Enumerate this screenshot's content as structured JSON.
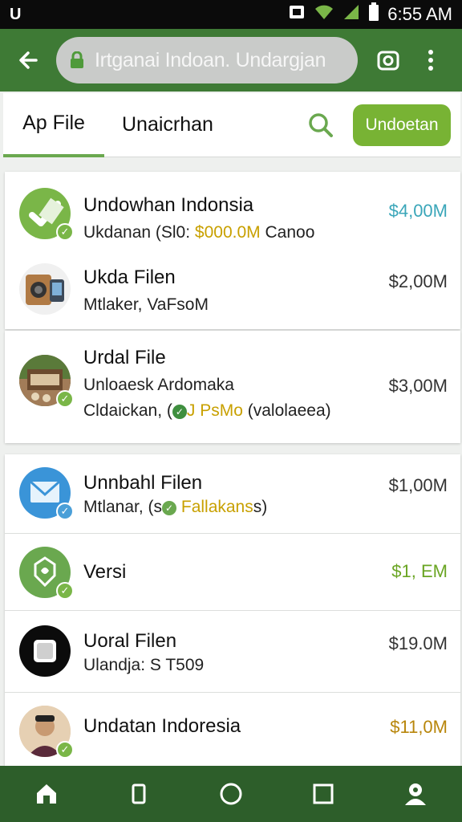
{
  "status_bar": {
    "left_glyph": "U",
    "time": "6:55 AM",
    "icons": [
      "notification-icon",
      "wifi-icon",
      "signal-icon",
      "battery-icon"
    ]
  },
  "app_bar": {
    "url_text": "Irtganai Indoan. Undargjan",
    "icons": [
      "back-arrow-icon",
      "lock-icon",
      "camera-icon",
      "more-vert-icon"
    ]
  },
  "tabs": {
    "tab1": "Ap File",
    "tab2": "Unaicrhan",
    "cta": "Undoetan"
  },
  "items": [
    {
      "title": "Undowhan Indonsia",
      "sub_pre": "Ukdanan (Sl0: ",
      "sub_hl": "$000.0M",
      "sub_post": " Canoo",
      "price": "$4,00M",
      "price_color": "#3aa6b9",
      "icon": "green-check-app-icon"
    },
    {
      "title": "Ukda Filen",
      "sub": "Mtlaker, VaFsoM",
      "price": "$2,00M",
      "price_color": "#333333",
      "icon": "camera-device-icon"
    },
    {
      "title": "Urdal File",
      "sub": "Unloaesk Ardomaka",
      "sub2_pre": "Cldaickan, (",
      "sub2_hl": "J PsMo",
      "sub2_post": " (valolaeea)",
      "price": "$3,00M",
      "price_color": "#333333",
      "icon": "market-photo-icon"
    },
    {
      "title": "Unnbahl Filen",
      "sub_pre": "Mtlanar, (s",
      "sub_hl": " Fallakans",
      "sub_post": "s)",
      "price": "$1,00M",
      "price_color": "#333333",
      "icon": "mail-app-icon"
    },
    {
      "title": "Versi",
      "price": "$1, EM",
      "price_color": "#6aa523",
      "icon": "leaf-app-icon"
    },
    {
      "title": "Uoral Filen",
      "sub": "Ulandja: S T509",
      "price": "$19.0M",
      "price_color": "#333333",
      "icon": "black-square-app-icon"
    },
    {
      "title": "Undatan Indoresia",
      "price": "$11,0M",
      "price_color": "#b8860b",
      "icon": "person-avatar-icon"
    }
  ],
  "nav": [
    "home-icon",
    "recent-phone-icon",
    "circle-home-icon",
    "square-overview-icon",
    "profile-icon"
  ]
}
